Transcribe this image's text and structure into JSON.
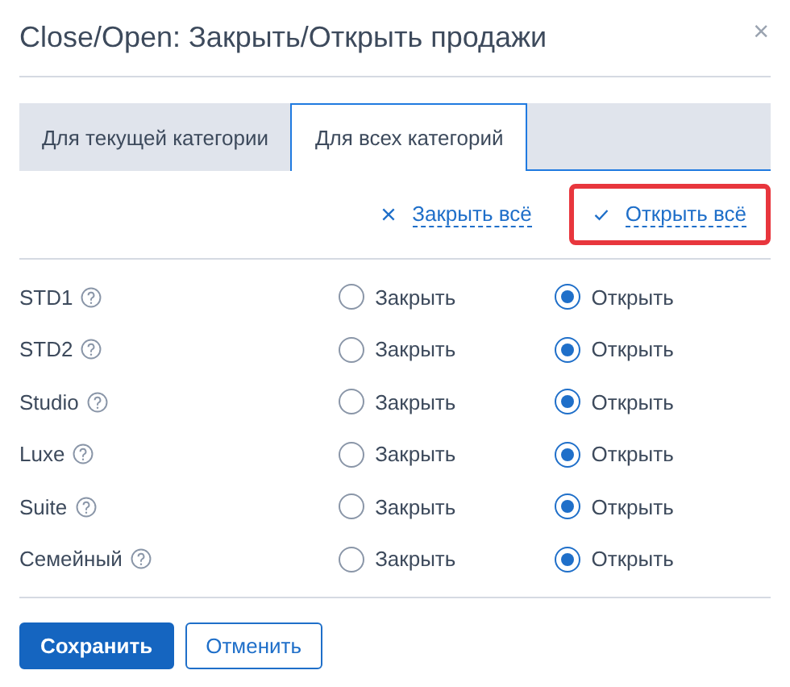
{
  "dialog": {
    "title": "Close/Open: Закрыть/Открыть продажи",
    "close": "×"
  },
  "tabs": [
    {
      "label": "Для текущей категории",
      "selected": false
    },
    {
      "label": "Для всех категорий",
      "selected": true
    }
  ],
  "bulk_actions": [
    {
      "kind": "close",
      "label": "Закрыть всё",
      "highlighted": false
    },
    {
      "kind": "open",
      "label": "Открыть всё",
      "highlighted": true
    }
  ],
  "categories": [
    {
      "name": "STD1",
      "options": [
        {
          "label": "Закрыть",
          "selected": false
        },
        {
          "label": "Открыть",
          "selected": true
        }
      ]
    },
    {
      "name": "STD2",
      "options": [
        {
          "label": "Закрыть",
          "selected": false
        },
        {
          "label": "Открыть",
          "selected": true
        }
      ]
    },
    {
      "name": "Studio",
      "options": [
        {
          "label": "Закрыть",
          "selected": false
        },
        {
          "label": "Открыть",
          "selected": true
        }
      ]
    },
    {
      "name": "Luxe",
      "options": [
        {
          "label": "Закрыть",
          "selected": false
        },
        {
          "label": "Открыть",
          "selected": true
        }
      ]
    },
    {
      "name": "Suite",
      "options": [
        {
          "label": "Закрыть",
          "selected": false
        },
        {
          "label": "Открыть",
          "selected": true
        }
      ]
    },
    {
      "name": "Семейный",
      "options": [
        {
          "label": "Закрыть",
          "selected": false
        },
        {
          "label": "Открыть",
          "selected": true
        }
      ]
    }
  ],
  "buttons": [
    {
      "kind": "primary",
      "label": "Сохранить"
    },
    {
      "kind": "secondary",
      "label": "Отменить"
    }
  ]
}
